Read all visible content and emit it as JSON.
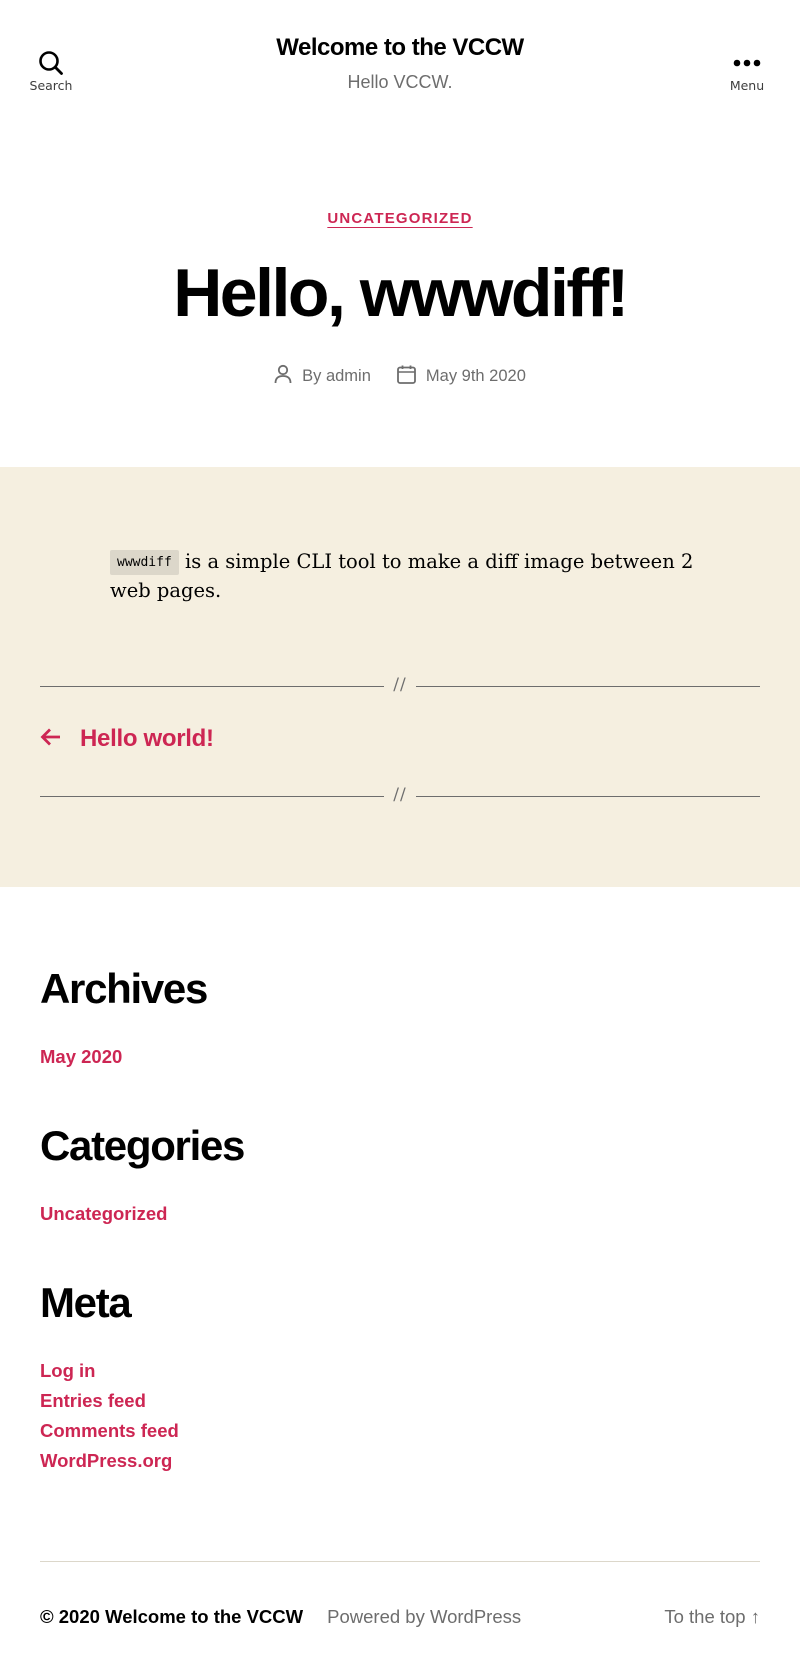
{
  "header": {
    "search_label": "Search",
    "menu_label": "Menu",
    "site_title": "Welcome to the VCCW",
    "site_description": "Hello VCCW."
  },
  "entry": {
    "category": "UNCATEGORIZED",
    "title": "Hello, wwwdiff!",
    "author_prefix": "By",
    "author": "admin",
    "date": "May 9th 2020",
    "content_code": "wwwdiff",
    "content_text": " is a simple CLI tool to make a diff image between 2 web pages."
  },
  "separator": {
    "glyph": "//"
  },
  "post_nav": {
    "previous_title": "Hello world!"
  },
  "widgets": {
    "archives": {
      "title": "Archives",
      "items": [
        "May 2020"
      ]
    },
    "categories": {
      "title": "Categories",
      "items": [
        "Uncategorized"
      ]
    },
    "meta": {
      "title": "Meta",
      "items": [
        "Log in",
        "Entries feed",
        "Comments feed",
        "WordPress.org"
      ]
    }
  },
  "footer": {
    "copyright_prefix": "© 2020",
    "copyright_site": "Welcome to the VCCW",
    "powered_by": "Powered by WordPress",
    "to_top": "To the top ↑"
  },
  "colors": {
    "accent": "#cd2653",
    "band_background": "#f5efe0",
    "meta_text": "#6d6d6d"
  },
  "icons": {
    "search": "search-icon",
    "menu": "ellipsis-icon",
    "author": "person-icon",
    "date": "calendar-icon",
    "prev": "arrow-left-icon"
  }
}
